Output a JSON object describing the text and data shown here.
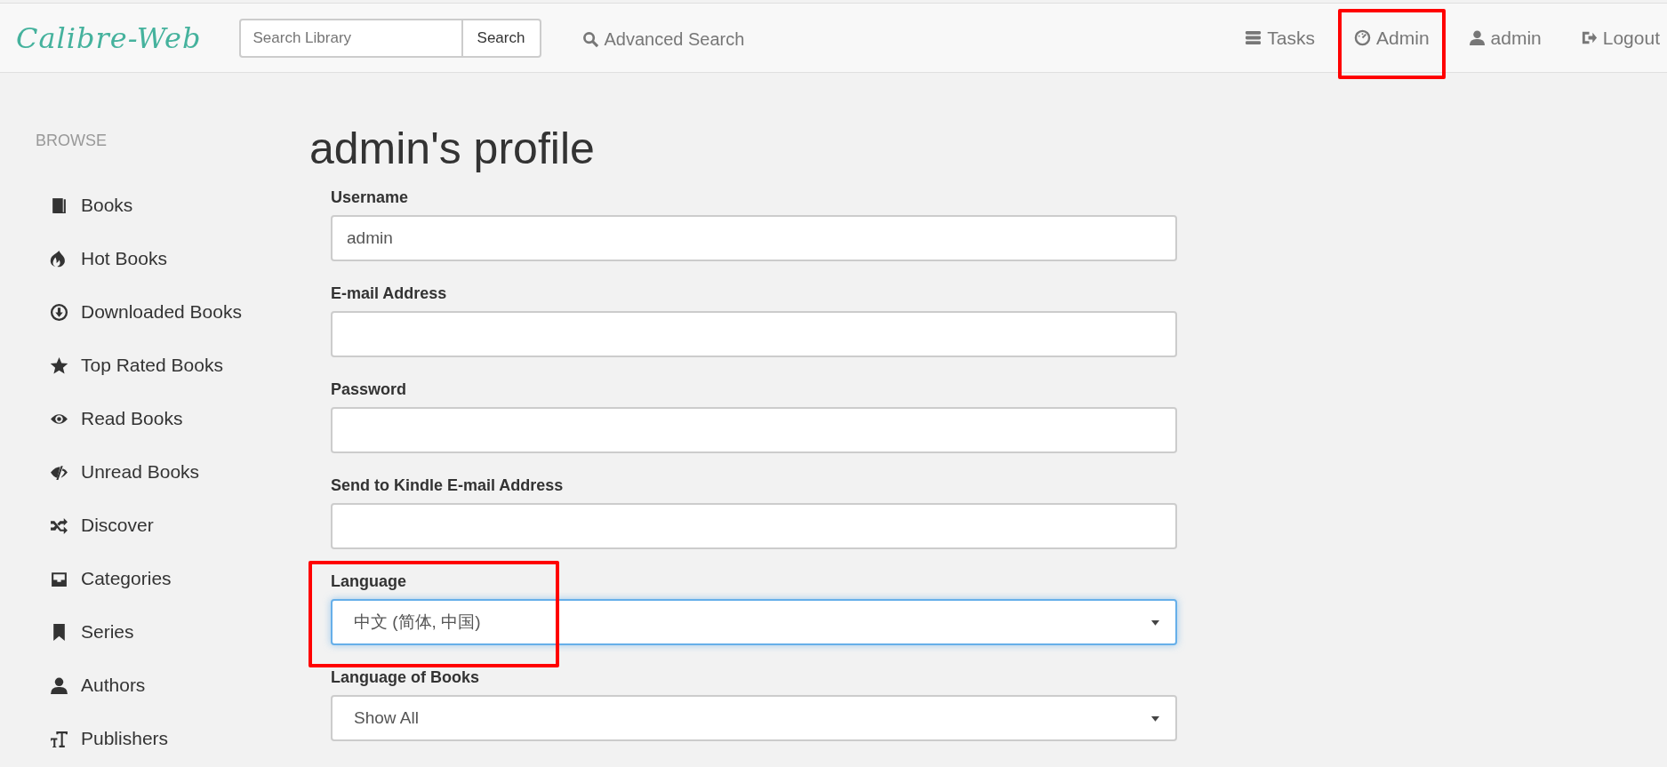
{
  "header": {
    "logo": "Calibre-Web",
    "search": {
      "placeholder": "Search Library",
      "button": "Search"
    },
    "advanced_search": "Advanced Search",
    "nav": [
      {
        "label": "Tasks",
        "highlighted": false
      },
      {
        "label": "Admin",
        "highlighted": true
      },
      {
        "label": "admin",
        "highlighted": false
      },
      {
        "label": "Logout",
        "highlighted": false
      }
    ]
  },
  "sidebar": {
    "heading": "BROWSE",
    "items": [
      {
        "label": "Books"
      },
      {
        "label": "Hot Books"
      },
      {
        "label": "Downloaded Books"
      },
      {
        "label": "Top Rated Books"
      },
      {
        "label": "Read Books"
      },
      {
        "label": "Unread Books"
      },
      {
        "label": "Discover"
      },
      {
        "label": "Categories"
      },
      {
        "label": "Series"
      },
      {
        "label": "Authors"
      },
      {
        "label": "Publishers"
      }
    ]
  },
  "profile": {
    "title": "admin's profile",
    "fields": [
      {
        "label": "Username",
        "kind": "text",
        "value": "admin",
        "focused": false,
        "highlighted": false
      },
      {
        "label": "E-mail Address",
        "kind": "text",
        "focused": false,
        "highlighted": false
      },
      {
        "label": "Password",
        "kind": "text",
        "focused": false,
        "highlighted": false
      },
      {
        "label": "Send to Kindle E-mail Address",
        "kind": "text",
        "focused": false,
        "highlighted": false
      },
      {
        "label": "Language",
        "kind": "select",
        "value": "中文 (简体, 中国)",
        "focused": true,
        "highlighted": true
      },
      {
        "label": "Language of Books",
        "kind": "select",
        "value": "Show All",
        "focused": false,
        "highlighted": false
      }
    ]
  }
}
